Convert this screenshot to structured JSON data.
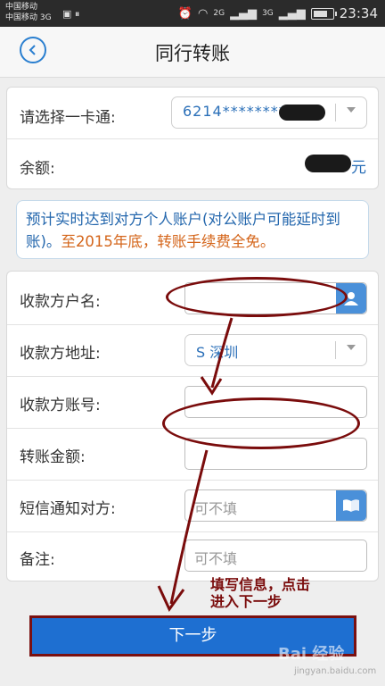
{
  "status_bar": {
    "carrier_1": "中国移动",
    "carrier_2": "中国移动 3G",
    "net_1": "2G",
    "net_2": "3G",
    "time": "23:34"
  },
  "header": {
    "title": "同行转账",
    "back_icon": "chevron-left-icon"
  },
  "account": {
    "card_label": "请选择一卡通:",
    "card_value": "6214*********",
    "balance_label": "余额:",
    "balance_unit": "元"
  },
  "notice": {
    "text_blue": "预计实时达到对方个人账户(对公账户可能延时到账)。",
    "text_orange": "至2015年底，转账手续费全免。"
  },
  "form": {
    "payee_name_label": "收款方户名:",
    "payee_address_label": "收款方地址:",
    "payee_address_value": "S 深圳",
    "payee_account_label": "收款方账号:",
    "amount_label": "转账金额:",
    "sms_label": "短信通知对方:",
    "sms_placeholder": "可不填",
    "remark_label": "备注:",
    "remark_placeholder": "可不填"
  },
  "annotation": {
    "line1": "填写信息，点击",
    "line2": "进入下一步"
  },
  "submit": {
    "label": "下一步"
  },
  "watermark": {
    "brand": "Bai 经验",
    "url": "jingyan.baidu.com"
  },
  "colors": {
    "accent": "#1e6fd1",
    "annotation": "#7a0c0c",
    "notice_blue": "#2467ad",
    "notice_orange": "#d4651a"
  }
}
